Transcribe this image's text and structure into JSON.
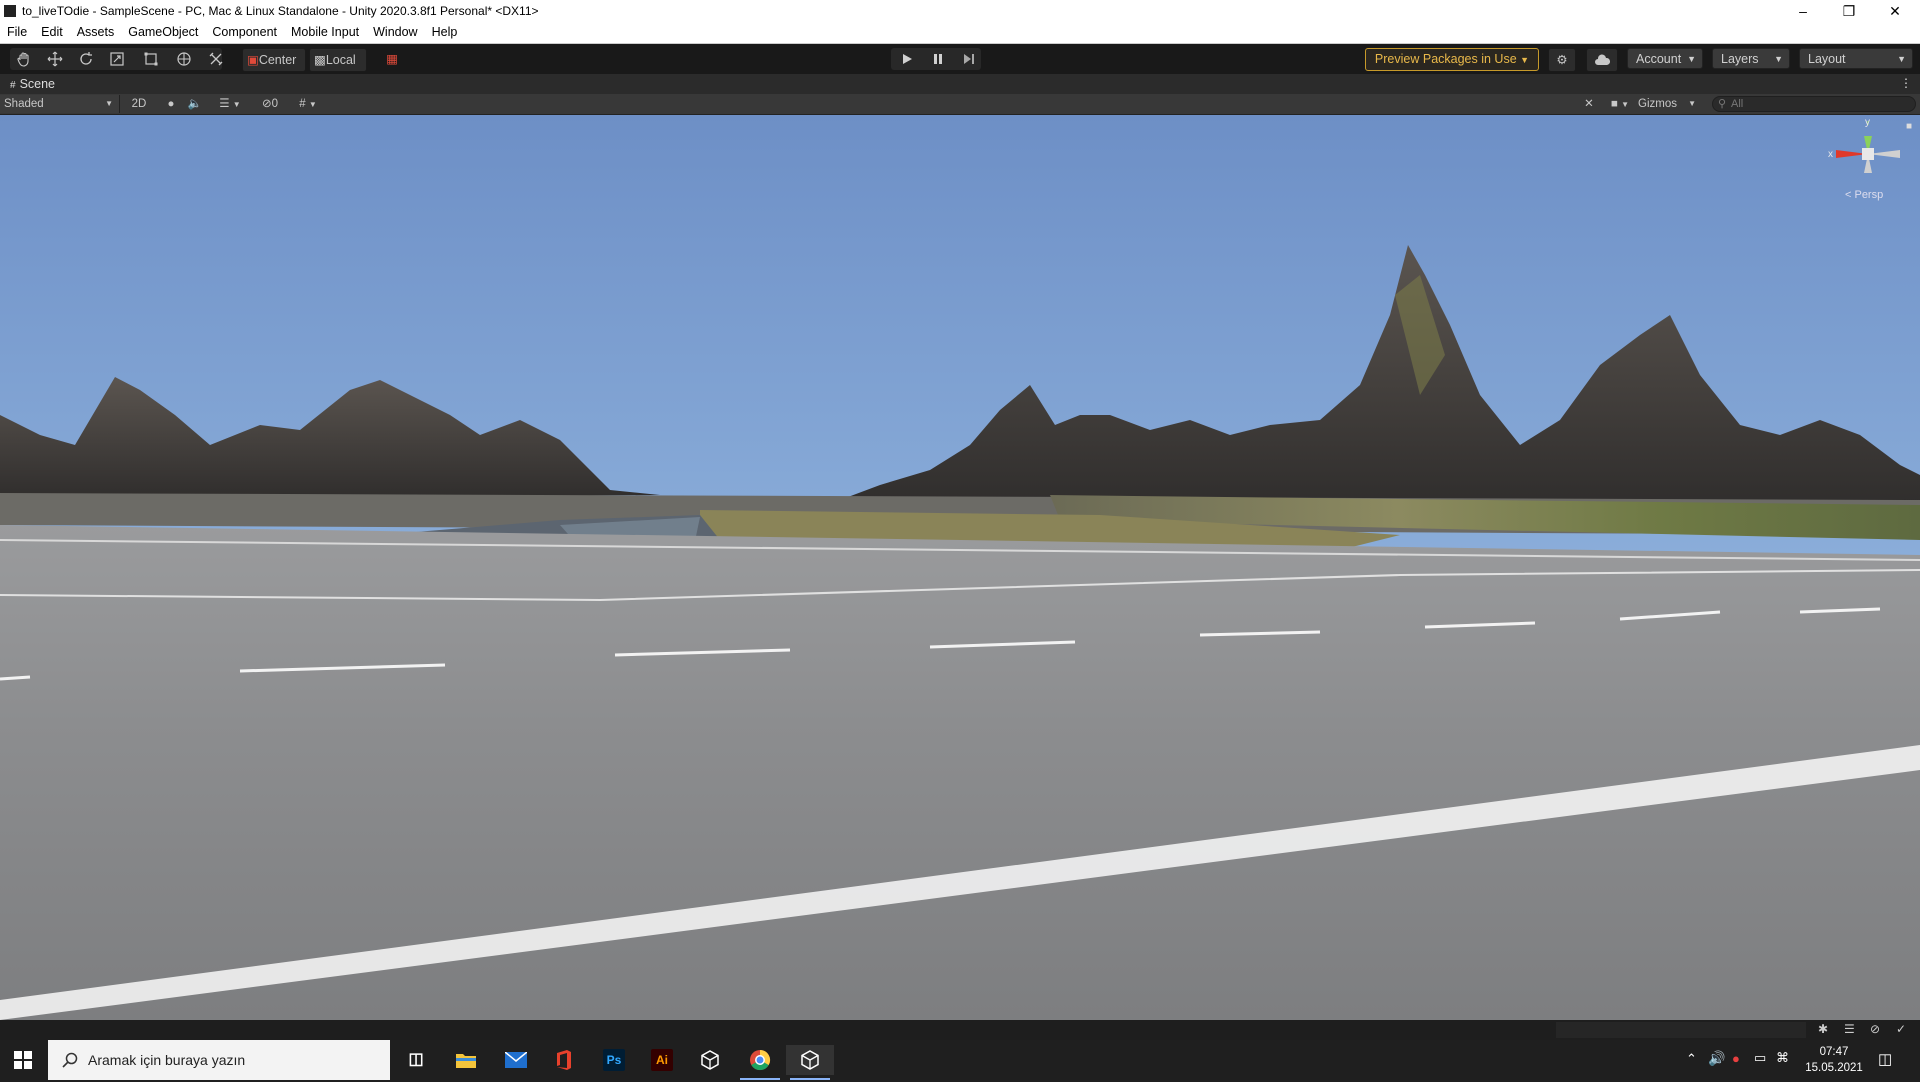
{
  "window": {
    "title": "to_liveTOdie - SampleScene - PC, Mac & Linux Standalone - Unity 2020.3.8f1 Personal* <DX11>",
    "minimize": "–",
    "restore": "❐",
    "close": "✕"
  },
  "menu": [
    "File",
    "Edit",
    "Assets",
    "GameObject",
    "Component",
    "Mobile Input",
    "Window",
    "Help"
  ],
  "toolbar": {
    "pivot_label": "Center",
    "space_label": "Local",
    "preview_packages": "Preview Packages in Use",
    "account": "Account",
    "layers": "Layers",
    "layout": "Layout"
  },
  "scene_tab": {
    "label": "Scene"
  },
  "scene_toolbar": {
    "draw_mode": "Shaded",
    "mode_2d": "2D",
    "hidden_count": "0",
    "gizmos": "Gizmos",
    "search_placeholder": "All"
  },
  "gizmo": {
    "x_label": "x",
    "y_label": "y",
    "projection": "< Persp"
  },
  "taskbar": {
    "search_placeholder": "Aramak için buraya yazın",
    "ps_label": "Ps",
    "ai_label": "Ai",
    "time": "07:47",
    "date": "15.05.2021"
  },
  "colors": {
    "accent_warning": "#e8b84a",
    "editor_dark": "#191919",
    "sky_top": "#6f93c8",
    "road": "#8f9092"
  }
}
